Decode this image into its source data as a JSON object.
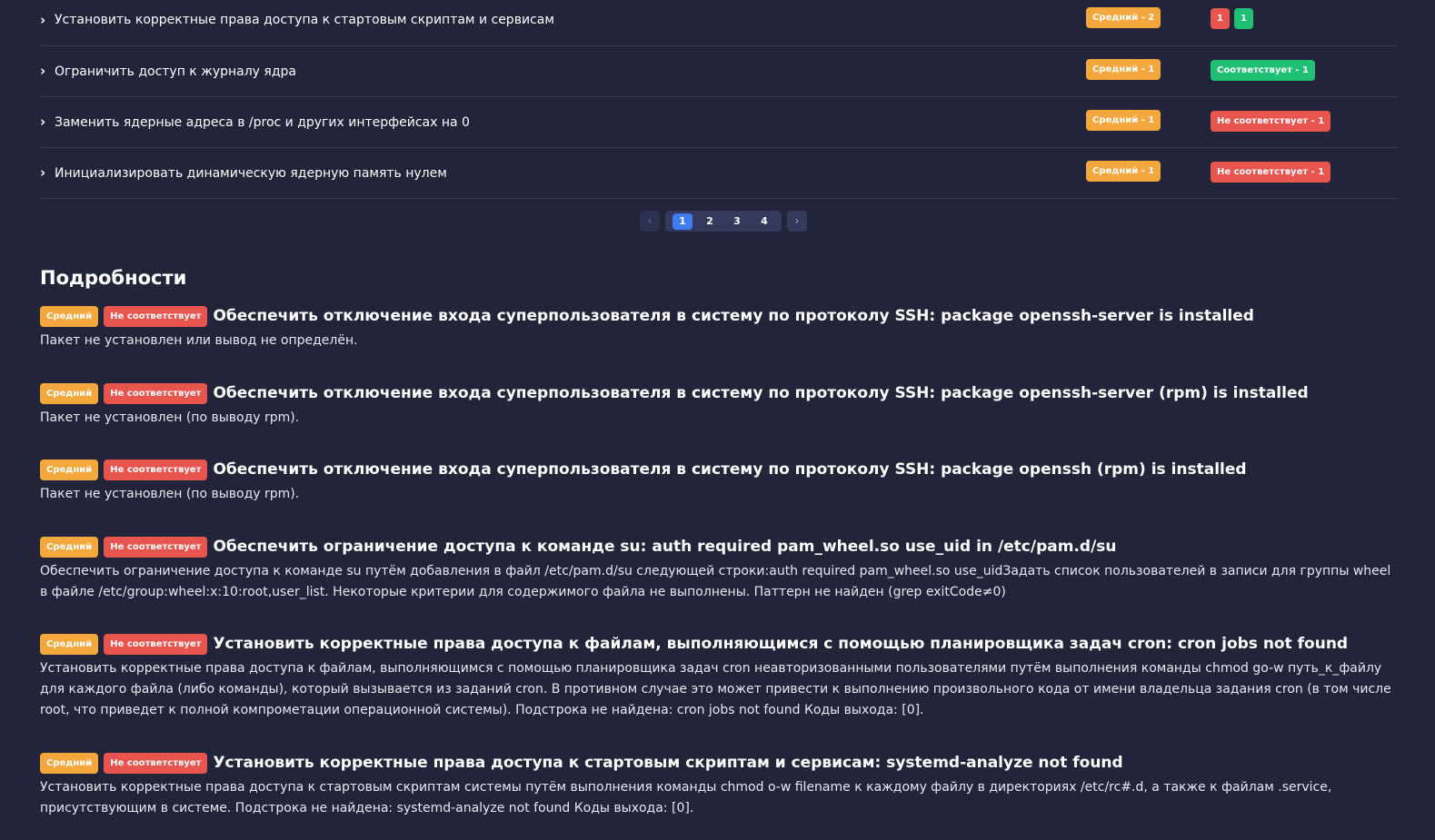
{
  "rules": [
    {
      "title": "Установить корректные права доступа к стартовым скриптам и сервисам",
      "severity": "Средний - 2",
      "result": [
        {
          "label": "1",
          "color": "red"
        },
        {
          "label": "1",
          "color": "green"
        }
      ]
    },
    {
      "title": "Ограничить доступ к журналу ядра",
      "severity": "Средний - 1",
      "result": [
        {
          "label": "Соответствует - 1",
          "color": "green"
        }
      ]
    },
    {
      "title": "Заменить ядерные адреса в /proc и других интерфейсах на 0",
      "severity": "Средний - 1",
      "result": [
        {
          "label": "Не соответствует - 1",
          "color": "red"
        }
      ]
    },
    {
      "title": "Инициализировать динамическую ядерную память нулем",
      "severity": "Средний - 1",
      "result": [
        {
          "label": "Не соответствует - 1",
          "color": "red"
        }
      ]
    }
  ],
  "pagination": {
    "prev": "‹",
    "next": "›",
    "pages": [
      "1",
      "2",
      "3",
      "4"
    ],
    "current": "1"
  },
  "details": {
    "heading": "Подробности",
    "items": [
      {
        "severity": "Средний",
        "status": "Не соответствует",
        "title": "Обеспечить отключение входа суперпользователя в систему по протоколу SSH: package openssh-server is installed",
        "description": "Пакет не установлен или вывод не определён."
      },
      {
        "severity": "Средний",
        "status": "Не соответствует",
        "title": "Обеспечить отключение входа суперпользователя в систему по протоколу SSH: package openssh-server (rpm) is installed",
        "description": "Пакет не установлен (по выводу rpm)."
      },
      {
        "severity": "Средний",
        "status": "Не соответствует",
        "title": "Обеспечить отключение входа суперпользователя в систему по протоколу SSH: package openssh (rpm) is installed",
        "description": "Пакет не установлен (по выводу rpm)."
      },
      {
        "severity": "Средний",
        "status": "Не соответствует",
        "title": "Обеспечить ограничение доступа к команде su: auth required pam_wheel.so use_uid in /etc/pam.d/su",
        "description": "Обеспечить ограничение доступа к команде su путём добавления в файл /etc/pam.d/su следующей строки:auth required pam_wheel.so use_uidЗадать список пользователей в записи для группы wheel в файле /etc/group:wheel:x:10:root,user_list. Некоторые критерии для содержимого файла не выполнены. Паттерн не найден (grep exitCode≠0)"
      },
      {
        "severity": "Средний",
        "status": "Не соответствует",
        "title": "Установить корректные права доступа к файлам, выполняющимся с помощью планировщика задач cron: cron jobs not found",
        "description": "Установить корректные права доступа к файлам, выполняющимся с помощью планировщика задач cron неавторизованными пользователями путём выполнения команды chmod go-w путь_к_файлу для каждого файла (либо команды), который вызывается из заданий cron. В противном случае это может привести к выполнению произвольного кода от имени владельца задания cron (в том числе root, что приведет к полной компрометации операционной системы). Подстрока не найдена: cron jobs not found Коды выхода: [0]."
      },
      {
        "severity": "Средний",
        "status": "Не соответствует",
        "title": "Установить корректные права доступа к стартовым скриптам и сервисам: systemd-analyze not found",
        "description": "Установить корректные права доступа к стартовым скриптам системы путём выполнения команды chmod o-w filename к каждому файлу в директориях /etc/rc#.d, а также к файлам .service, присутствующим в системе. Подстрока не найдена: systemd-analyze not found Коды выхода: [0]."
      }
    ]
  },
  "colors": {
    "background": "#22243a",
    "orange": "#f3a73d",
    "red": "#e8544e",
    "green": "#1fbf74",
    "active_page": "#3f7cf0"
  }
}
